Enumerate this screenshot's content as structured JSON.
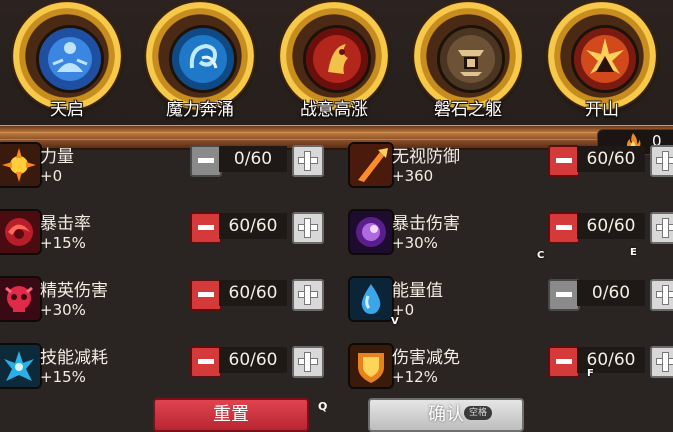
{
  "abilities": [
    {
      "label": "天启",
      "icon": "meditating-figure-icon",
      "color": "#3d7fd6"
    },
    {
      "label": "魔力奔涌",
      "icon": "phoenix-swirl-icon",
      "color": "#2a8fd8"
    },
    {
      "label": "战意高涨",
      "icon": "battle-spirit-icon",
      "color": "#b3261c"
    },
    {
      "label": "磐石之躯",
      "icon": "stone-body-icon",
      "color": "#7a5a3a"
    },
    {
      "label": "开山",
      "icon": "mountain-split-icon",
      "color": "#c0392b"
    }
  ],
  "points": {
    "value": "0",
    "icon": "flame-icon"
  },
  "stats": [
    {
      "name": "力量",
      "bonus": "+0",
      "value": "0/60",
      "minus_disabled": true,
      "icon": "sun-power-icon"
    },
    {
      "name": "无视防御",
      "bonus": "+360",
      "value": "60/60",
      "minus_disabled": false,
      "icon": "armor-pierce-icon"
    },
    {
      "name": "暴击率",
      "bonus": "+15%",
      "value": "60/60",
      "minus_disabled": false,
      "icon": "crit-rate-icon"
    },
    {
      "name": "暴击伤害",
      "bonus": "+30%",
      "value": "60/60",
      "minus_disabled": false,
      "icon": "crit-damage-icon"
    },
    {
      "name": "精英伤害",
      "bonus": "+30%",
      "value": "60/60",
      "minus_disabled": false,
      "icon": "elite-skull-icon"
    },
    {
      "name": "能量值",
      "bonus": "+0",
      "value": "0/60",
      "minus_disabled": true,
      "icon": "energy-drop-icon"
    },
    {
      "name": "技能减耗",
      "bonus": "+15%",
      "value": "60/60",
      "minus_disabled": false,
      "icon": "skill-cost-icon"
    },
    {
      "name": "伤害减免",
      "bonus": "+12%",
      "value": "60/60",
      "minus_disabled": false,
      "icon": "shield-icon"
    }
  ],
  "key_hints": {
    "c": "C",
    "e": "E",
    "v": "V",
    "f": "F",
    "q": "Q"
  },
  "buttons": {
    "reset": "重置",
    "confirm": "确认",
    "confirm_hint": "空格"
  }
}
